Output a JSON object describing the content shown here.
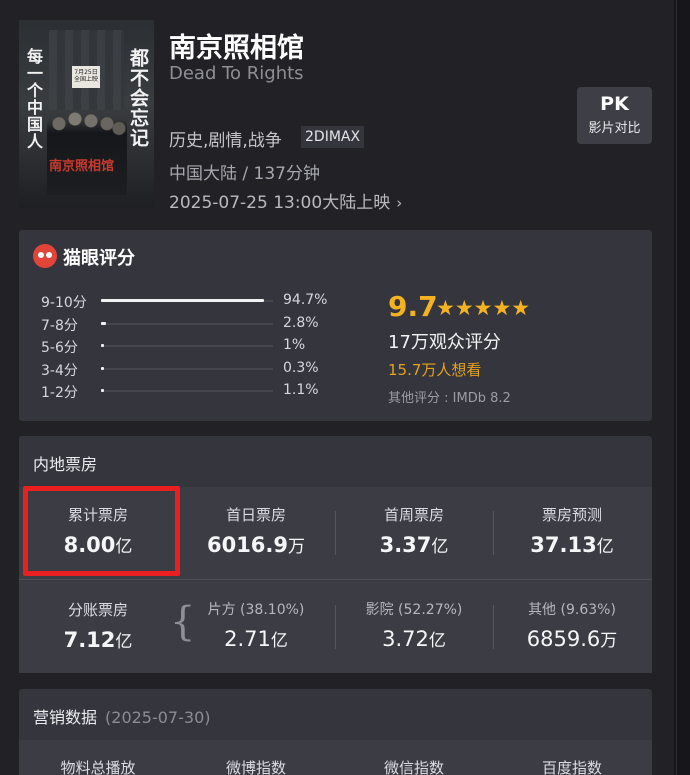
{
  "movie": {
    "poster": {
      "left_text": "每一个中国人",
      "right_text": "都不会忘记",
      "sign_text": "7月25日 全国上映",
      "title_text": "南京照相馆"
    },
    "title_cn": "南京照相馆",
    "title_en": "Dead To Rights",
    "genre": "历史,剧情,战争",
    "format_badge": "2DIMAX",
    "meta": "中国大陆 / 137分钟",
    "release": "2025-07-25 13:00大陆上映"
  },
  "pk_button": {
    "main": "PK",
    "sub": "影片对比"
  },
  "rating": {
    "title": "猫眼评分",
    "distribution": [
      {
        "label": "9-10分",
        "pct": "94.7%",
        "value": 94.7
      },
      {
        "label": "7-8分",
        "pct": "2.8%",
        "value": 2.8
      },
      {
        "label": "5-6分",
        "pct": "1%",
        "value": 1
      },
      {
        "label": "3-4分",
        "pct": "0.3%",
        "value": 0.3
      },
      {
        "label": "1-2分",
        "pct": "1.1%",
        "value": 1.1
      }
    ],
    "score": "9.7",
    "stars": "★★★★★",
    "audience": "17万观众评分",
    "want": "15.7万人想看",
    "other": "其他评分 : IMDb 8.2"
  },
  "box_office": {
    "title": "内地票房",
    "cumulative": {
      "label": "累计票房",
      "value": "8.00",
      "unit": "亿"
    },
    "first_day": {
      "label": "首日票房",
      "value": "6016.9",
      "unit": "万"
    },
    "first_week": {
      "label": "首周票房",
      "value": "3.37",
      "unit": "亿"
    },
    "forecast": {
      "label": "票房预测",
      "value": "37.13",
      "unit": "亿"
    },
    "split": {
      "label": "分账票房",
      "value": "7.12",
      "unit": "亿"
    },
    "producer": {
      "label": "片方 (38.10%)",
      "value": "2.71",
      "unit": "亿"
    },
    "cinema": {
      "label": "影院 (52.27%)",
      "value": "3.72",
      "unit": "亿"
    },
    "others": {
      "label": "其他 (9.63%)",
      "value": "6859.6",
      "unit": "万"
    }
  },
  "marketing": {
    "title": "营销数据",
    "date": "(2025-07-30)",
    "columns": [
      "物料总播放",
      "微博指数",
      "微信指数",
      "百度指数"
    ]
  },
  "colors": {
    "accent": "#f5b220",
    "highlight": "#ea1f1f",
    "background": "#212126",
    "card": "#35353d"
  }
}
